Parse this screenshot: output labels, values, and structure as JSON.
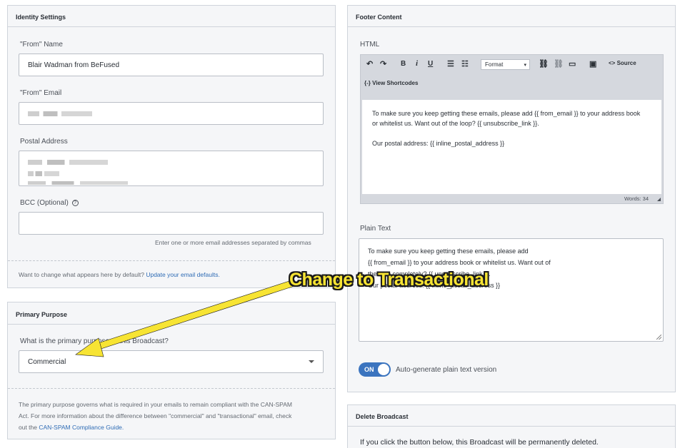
{
  "identity": {
    "title": "Identity Settings",
    "from_name_label": "\"From\" Name",
    "from_name_value": "Blair Wadman from BeFused",
    "from_email_label": "\"From\" Email",
    "postal_label": "Postal Address",
    "bcc_label": "BCC (Optional)",
    "bcc_hint": "Enter one or more email addresses separated by commas",
    "defaults_text": "Want to change what appears here by default?",
    "defaults_link": "Update your email defaults."
  },
  "purpose": {
    "title": "Primary Purpose",
    "question": "What is the primary purpose of this Broadcast?",
    "selected": "Commercial",
    "info_1": "The primary purpose governs what is required in your emails to remain compliant with the CAN-SPAM",
    "info_2": "Act. For more information about the difference between \"commercial\" and \"transactional\" email, check",
    "info_3": "out the",
    "info_link": "CAN-SPAM Compliance Guide."
  },
  "footer": {
    "title": "Footer Content",
    "html_label": "HTML",
    "format_label": "Format",
    "source_label": "Source",
    "shortcodes_label": "View Shortcodes",
    "html_line1": "To make sure you keep getting these emails, please add {{ from_email }} to your address book",
    "html_line2": "or whitelist us. Want out of the loop? {{ unsubscribe_link }}.",
    "html_line3": "Our postal address: {{ inline_postal_address }}",
    "words": "Words: 34",
    "plain_label": "Plain Text",
    "plain_line1": "To make sure you keep getting these emails, please add",
    "plain_line2": "{{ from_email }} to your address book or whitelist us. Want out of",
    "plain_line3": "the loop completely? {{ unsubscribe_link }}.",
    "plain_line4": "Our postal address: {{ inline_postal_address }}",
    "toggle_label": "ON",
    "autogen_label": "Auto-generate plain text version"
  },
  "delete": {
    "title": "Delete Broadcast",
    "text": "If you click the button below, this Broadcast will be permanently deleted."
  },
  "annotation": {
    "text": "Change to Transactional",
    "color": "#f7e433"
  }
}
